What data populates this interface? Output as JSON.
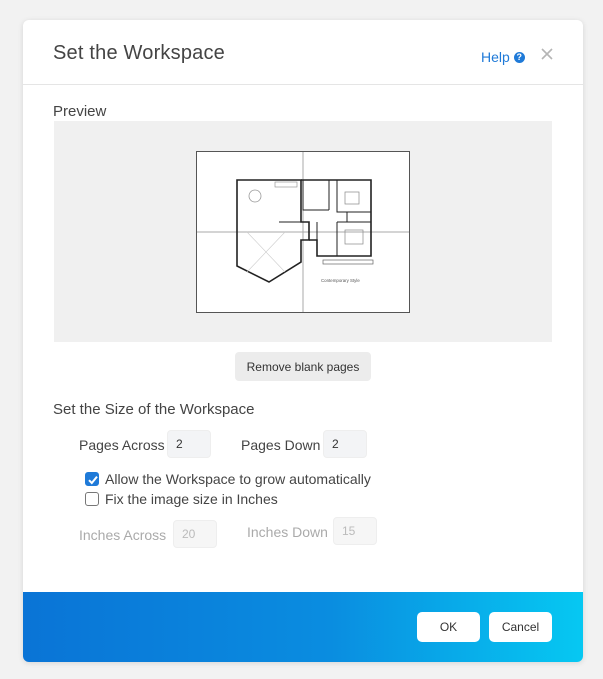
{
  "dialog": {
    "title": "Set the Workspace",
    "help_label": "Help",
    "help_icon": "question-circle-icon",
    "close_icon": "close-icon"
  },
  "preview": {
    "label": "Preview",
    "plan_caption": "Contemporary Style",
    "remove_blank_label": "Remove blank pages"
  },
  "size": {
    "label": "Set the Size of the Workspace",
    "pages_across_label": "Pages Across",
    "pages_across_value": "2",
    "pages_down_label": "Pages Down",
    "pages_down_value": "2",
    "grow_label": "Allow the Workspace to grow automatically",
    "grow_checked": true,
    "fix_label": "Fix the image size in Inches",
    "fix_checked": false,
    "inches_across_label": "Inches Across",
    "inches_across_placeholder": "20",
    "inches_down_label": "Inches Down",
    "inches_down_placeholder": "15"
  },
  "footer": {
    "ok_label": "OK",
    "cancel_label": "Cancel"
  },
  "colors": {
    "accent": "#1f7ad8",
    "footer_start": "#0a74d6",
    "footer_end": "#06c8f2"
  }
}
